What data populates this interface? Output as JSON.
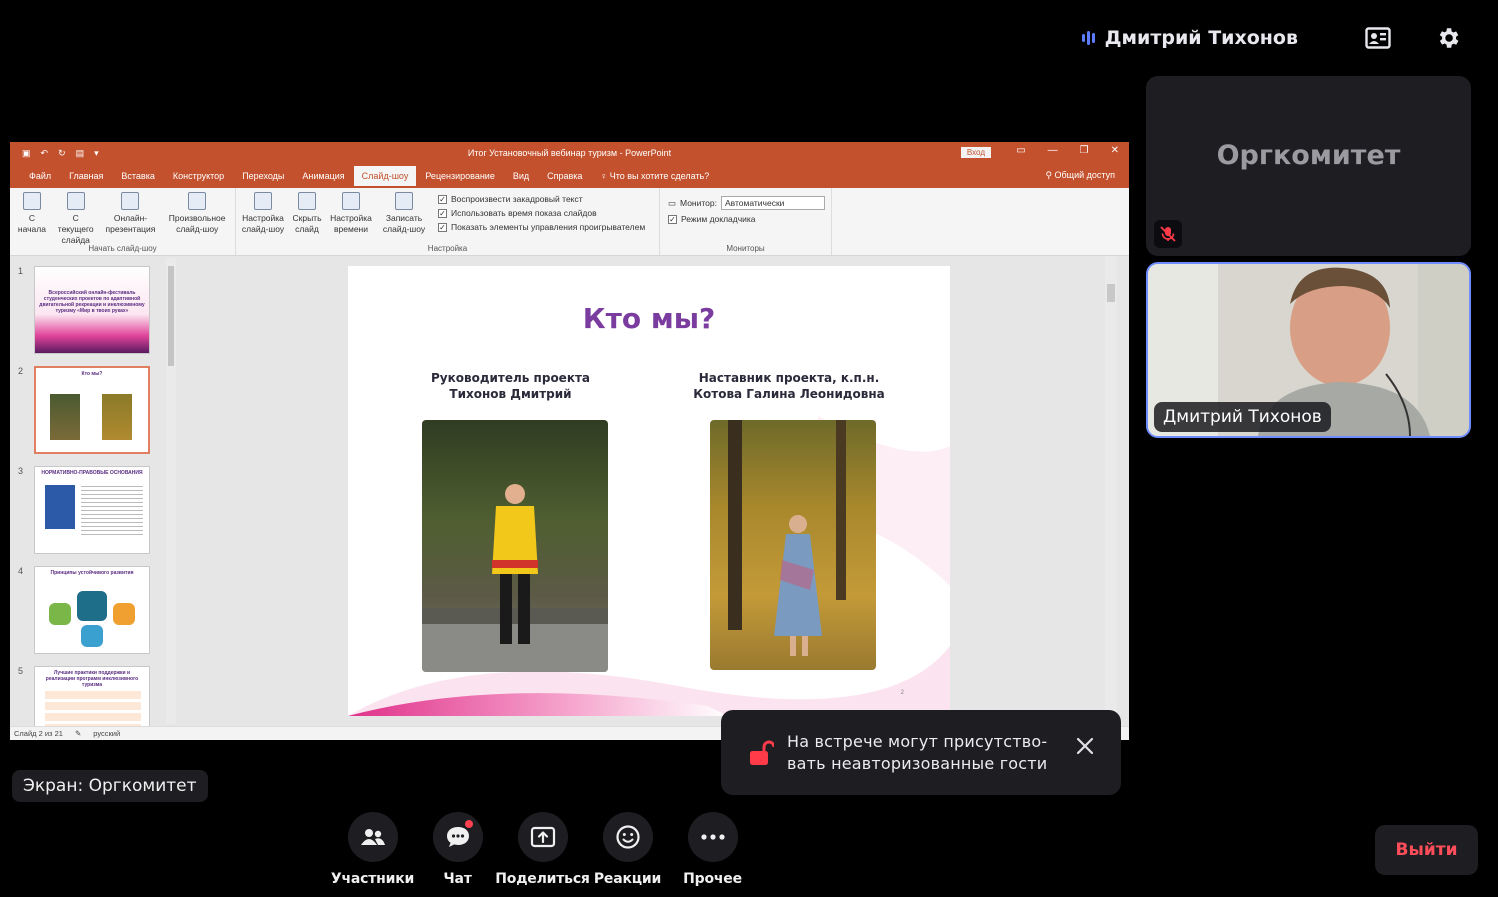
{
  "header": {
    "active_speaker_name": "Дмитрий Тихонов",
    "speaker_icon": "audio-level-icon",
    "layout_icon": "contact-card-icon",
    "settings_icon": "gear-icon"
  },
  "screen_share": {
    "label": "Экран: Оргкомитет",
    "powerpoint": {
      "window_title": "Итог Установочный вебинар туризм  -  PowerPoint",
      "login_button": "Вход",
      "tabs": [
        "Файл",
        "Главная",
        "Вставка",
        "Конструктор",
        "Переходы",
        "Анимация",
        "Слайд-шоу",
        "Рецензирование",
        "Вид",
        "Справка"
      ],
      "active_tab": "Слайд-шоу",
      "tell_me": "Что вы хотите сделать?",
      "share": "Общий доступ",
      "ribbon": {
        "start_group_label": "Начать слайд-шоу",
        "start_buttons": [
          "С начала",
          "С текущего слайда",
          "Онлайн-презентация",
          "Произвольное слайд-шоу"
        ],
        "setup_group_label": "Настройка",
        "setup_buttons": [
          "Настройка слайд-шоу",
          "Скрыть слайд",
          "Настройка времени",
          "Записать слайд-шоу"
        ],
        "checkboxes": [
          "Воспроизвести закадровый текст",
          "Использовать время показа слайдов",
          "Показать элементы управления проигрывателем"
        ],
        "monitors_group_label": "Мониторы",
        "monitor_label": "Монитор:",
        "monitor_value": "Автоматически",
        "presenter_view": "Режим докладчика"
      },
      "thumbnails": [
        {
          "num": "1",
          "title": "Всероссийский онлайн-фестиваль студенческих проектов по адаптивной двигательной рекреации и инклюзивному туризму «Мир в твоих руках»"
        },
        {
          "num": "2",
          "title": "Кто мы?"
        },
        {
          "num": "3",
          "title": "НОРМАТИВНО-ПРАВОВЫЕ ОСНОВАНИЯ"
        },
        {
          "num": "4",
          "title": "Принципы устойчивого развития"
        },
        {
          "num": "5",
          "title": "Лучшие практики поддержки и реализации программ инклюзивного туризма"
        }
      ],
      "slide": {
        "title": "Кто мы?",
        "left_caption_line1": "Руководитель проекта",
        "left_caption_line2": "Тихонов Дмитрий",
        "right_caption_line1": "Наставник проекта, к.п.н.",
        "right_caption_line2": "Котова Галина Леонидовна",
        "page_number": "2"
      },
      "status": {
        "slide_counter": "Слайд 2 из 21",
        "language": "русский"
      }
    }
  },
  "toast": {
    "icon": "unlocked-padlock-icon",
    "text_line1": "На встрече могут присутство-",
    "text_line2": "вать неавторизованные гости",
    "accent_color": "#ff3b4a"
  },
  "participants": [
    {
      "name": "Оргкомитет",
      "muted": true,
      "video": false
    },
    {
      "name": "Дмитрий Тихонов",
      "muted": false,
      "video": true
    }
  ],
  "controls": [
    {
      "label": "Участники",
      "icon": "participants-icon"
    },
    {
      "label": "Чат",
      "icon": "chat-icon",
      "has_notification": true
    },
    {
      "label": "Поделиться",
      "icon": "share-screen-icon"
    },
    {
      "label": "Реакции",
      "icon": "smiley-icon"
    },
    {
      "label": "Прочее",
      "icon": "more-dots-icon"
    }
  ],
  "leave_button": "Выйти",
  "colors": {
    "background": "#000000",
    "panel": "#1e1e22",
    "speaking_border": "#6f8cff",
    "leave_text": "#ff4d5a",
    "ppt_accent": "#c4512d"
  }
}
